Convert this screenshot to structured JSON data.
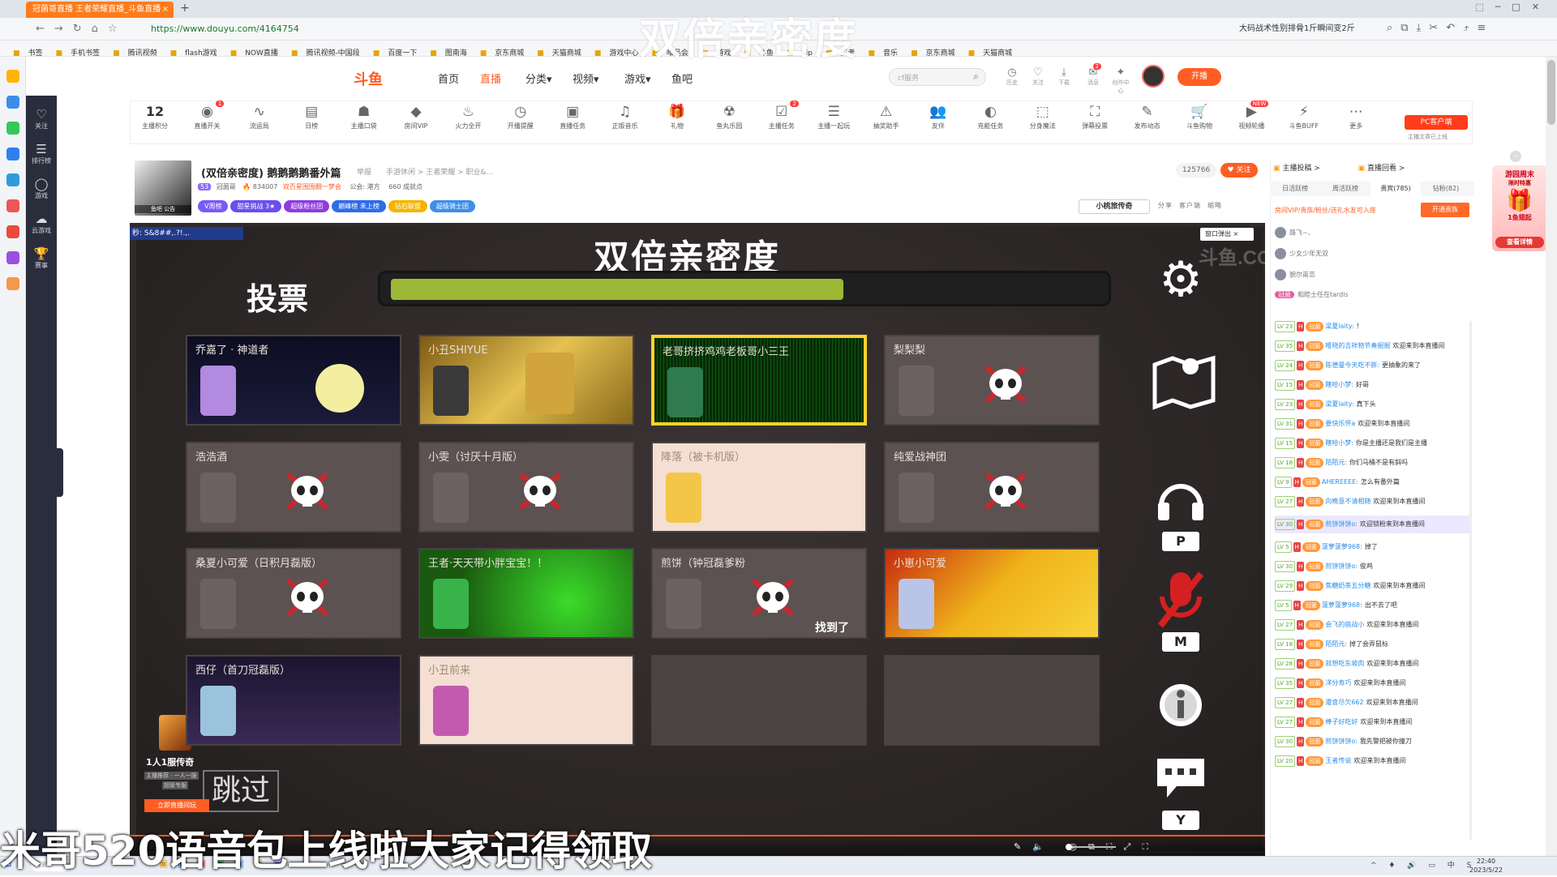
{
  "browser": {
    "tab_title": "冠菌哥直播 王者荣耀直播_斗鱼直播",
    "tab_close": "×",
    "new_tab": "+",
    "url": "https://www.douyu.com/4164754",
    "search_suggestion": "大码战术性别排骨1斤瞬间变2斤",
    "bookmarks": [
      "书签",
      "手机书签",
      "腾讯视频",
      "flash游戏",
      "NOW直播",
      "腾讯视频-中国段",
      "百度一下",
      "图南海",
      "京东商城",
      "天猫商城",
      "游戏中心",
      "唯品会",
      "游戏",
      "斗鱼",
      "vip",
      "王者",
      "音乐",
      "京东商城",
      "天猫商城"
    ]
  },
  "header": {
    "logo": "斗鱼",
    "nav": [
      "首页",
      "直播",
      "分类▾",
      "视频▾",
      "游戏▾",
      "鱼吧"
    ],
    "search_placeholder": "cf服务",
    "icons": [
      "历史",
      "关注",
      "下载",
      "消息",
      "创作中心"
    ],
    "msg_badge": "2",
    "open_live": "开播"
  },
  "douyu_sidebar": [
    "关注",
    "排行榜",
    "游戏",
    "云游戏",
    "赛事"
  ],
  "toolbar": {
    "score": "12",
    "items": [
      "主播积分",
      "直播开关",
      "流运局",
      "日榜",
      "主播口袋",
      "房间VIP",
      "火力全开",
      "开播提醒",
      "直播任务",
      "正版音乐",
      "礼物",
      "鱼丸乐园",
      "主播任务",
      "主播一起玩",
      "抽奖助手",
      "友伴",
      "充能任务",
      "分身魔法",
      "弹幕投票",
      "发布动态",
      "斗鱼购物",
      "视频轮播",
      "斗鱼BUFF",
      "更多"
    ],
    "badges": {
      "live": "1",
      "task": "2",
      "video": "NEW"
    },
    "pc_client": "PC客户端",
    "pc_sub": "主播文章已上线"
  },
  "room": {
    "avatar_label": "鱼吧  公告",
    "title": "(双倍亲密度) 鹅鹅鹅鹅番外篇",
    "report": "举报",
    "category": "手游休闲 > 王者荣耀 > 职业&...",
    "level": "53",
    "host": "冠菌哥",
    "heat": "834007",
    "champion": "双百星围围翻一梦会",
    "notice": "公会: 港方",
    "followers_count": "660 成就点",
    "tags": [
      "V周榜",
      "甜星挑战 3★",
      "超级粉丝团",
      "巅峰榜 未上榜",
      "钻石联盟",
      "超级骑士团"
    ],
    "fans": "125766",
    "follow": "关注",
    "xiaobao": "小桃旅传奇",
    "actions": [
      "分享",
      "客户端",
      "缩略"
    ]
  },
  "game": {
    "title": "双倍亲密度",
    "vote": "投票",
    "vote_progress": 0.64,
    "popout": "窗口弹出 ×",
    "watermark": "斗鱼.COM",
    "danmu": "秒: S&8##,.?!.,.",
    "cards": [
      {
        "name": "乔嘉了 · 神道者",
        "state": "alive",
        "bg": "night"
      },
      {
        "name": "小丑SHIYUE",
        "state": "alive",
        "bg": "gold"
      },
      {
        "name": "老哥挤挤鸡鸡老板哥小三王",
        "state": "alive",
        "bg": "matrix",
        "selected": true
      },
      {
        "name": "梨梨梨",
        "state": "dead"
      },
      {
        "name": "浩浩酒",
        "state": "dead"
      },
      {
        "name": "小雯（讨厌十月版）",
        "state": "dead"
      },
      {
        "name": "降落（被卡机版）",
        "state": "alive",
        "bg": "bright"
      },
      {
        "name": "纯爱战神团",
        "state": "dead"
      },
      {
        "name": "桑夏小可爱（日积月磊版）",
        "state": "dead"
      },
      {
        "name": "王者·天天带小胖宝宝！！",
        "state": "alive",
        "bg": "green"
      },
      {
        "name": "煎饼（钟冠磊爹粉",
        "state": "dead",
        "found": "找到了"
      },
      {
        "name": "小崽小可爱",
        "state": "alive",
        "bg": "battle"
      },
      {
        "name": "西仔（首刀冠磊版）",
        "state": "alive",
        "bg": "night2"
      },
      {
        "name": "小丑前来",
        "state": "alive",
        "bg": "bright"
      },
      {
        "name": "",
        "state": "empty"
      },
      {
        "name": "",
        "state": "empty"
      }
    ],
    "side_keys": [
      "P",
      "M",
      "Y"
    ],
    "skip": "跳过"
  },
  "promo": {
    "title": "1人1服传奇",
    "sub1": "主播推荐 · 一人一服",
    "sub2": "超级专服",
    "btn": "立即直播间玩"
  },
  "overlay": {
    "top": "双倍亲密度",
    "bottom": "米哥520语音包上线啦大家记得领取"
  },
  "chat_panel": {
    "top_left": "主播投稿 >",
    "top_right": "直播回看 >",
    "tabs": [
      "日活跃榜",
      "周活跃榜",
      "贵宾(785)",
      "钻粉(82)"
    ],
    "active_tab": 2,
    "vip_line": "房间VIP/贵族/粉丝/送礼水友可入座",
    "vip_btn": "开通贵族",
    "top3": [
      "路飞~、",
      "少女少年无双",
      "貌尔南恋"
    ],
    "banner": "和睦士任在tardis",
    "messages": [
      {
        "lv": "LV 23",
        "user": "梁夏laity:",
        "text": "！"
      },
      {
        "lv": "LV 35",
        "user": "唯晓的吉祥物节奏掘掘",
        "text": "欢迎来到本直播间"
      },
      {
        "lv": "LV 24",
        "user": "陈德曼今天吃不胖:",
        "text": "更抽象的来了"
      },
      {
        "lv": "LV 15",
        "user": "瞎哈小梦:",
        "text": "好哥"
      },
      {
        "lv": "LV 23",
        "user": "梁夏laity:",
        "text": "真下头"
      },
      {
        "lv": "LV 31",
        "user": "要快乐怀a",
        "text": "欢迎来到本直播间"
      },
      {
        "lv": "LV 15",
        "user": "瞎哈小梦:",
        "text": "你是主播还是我们是主播"
      },
      {
        "lv": "LV 18",
        "user": "陌陌元:",
        "text": "你们马桶不是有斜吗"
      },
      {
        "lv": "LV 9",
        "user": "AHEREEEE:",
        "text": "怎么有番外篇"
      },
      {
        "lv": "LV 27",
        "user": "向晚意不请相随",
        "text": "欢迎来到本直播间"
      },
      {
        "lv": "LV 30",
        "user": "煎饼饼饼o:",
        "text": "欢迎锁粉来到本直播间",
        "hl": true
      },
      {
        "lv": "LV 5",
        "user": "菠萝菠萝968:",
        "text": "掉了"
      },
      {
        "lv": "LV 30",
        "user": "煎饼饼饼o:",
        "text": "俊鸡"
      },
      {
        "lv": "LV 29",
        "user": "焦糖奶茶五分糖",
        "text": "欢迎来到本直播间"
      },
      {
        "lv": "LV 5",
        "user": "菠萝菠萝968:",
        "text": "出不去了吧"
      },
      {
        "lv": "LV 27",
        "user": "会飞的挑战小",
        "text": "欢迎来到本直播间"
      },
      {
        "lv": "LV 18",
        "user": "陌陌元:",
        "text": "掉了会弄鼠标"
      },
      {
        "lv": "LV 28",
        "user": "就想吃东坡肉",
        "text": "欢迎来到本直播间"
      },
      {
        "lv": "LV 35",
        "user": "洋分寿巧",
        "text": "欢迎来到本直播间"
      },
      {
        "lv": "LV 27",
        "user": "還會尽欠662",
        "text": "欢迎来到本直播间"
      },
      {
        "lv": "LV 27",
        "user": "棒子好吃好",
        "text": "欢迎来到本直播间"
      },
      {
        "lv": "LV 30",
        "user": "煎饼饼饼o:",
        "text": "我先警把被你撞刀"
      },
      {
        "lv": "LV 20",
        "user": "王者传说",
        "text": "欢迎来到本直播间"
      }
    ]
  },
  "float_ad": {
    "title": "游园周末",
    "sub": "限时特惠",
    "price": "1鱼翅起",
    "btn": "查看详情"
  },
  "taskbar": {
    "search": "搜索",
    "time": "22:40",
    "date": "2023/5/22",
    "tray_lang": "中"
  },
  "colors": {
    "brand": "#ff5d23",
    "vote_fill": "#9db834",
    "selected_border": "#ffd32a",
    "sidebar_bg": "#2a2d3c"
  }
}
